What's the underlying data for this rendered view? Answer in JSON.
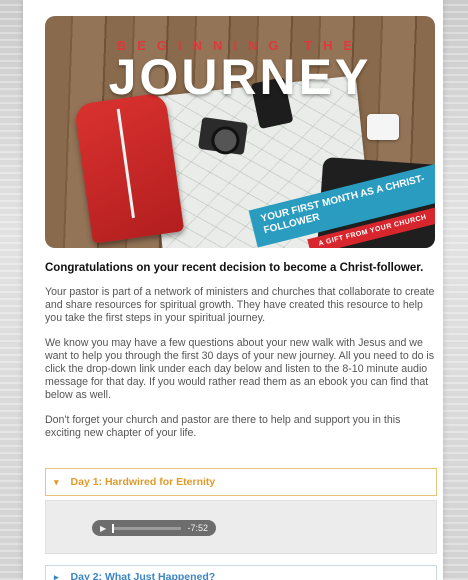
{
  "hero": {
    "title_top": "BEGINNING THE",
    "title_main": "JOURNEY",
    "banner": "YOUR FIRST MONTH AS A CHRIST-FOLLOWER",
    "gift": "A GIFT FROM YOUR CHURCH"
  },
  "content": {
    "headline": "Congratulations on your recent decision to become a Christ-follower.",
    "paragraphs": [
      "Your pastor is part of a network of ministers and churches that collaborate to create and share resources for spiritual growth. They have created this resource to help you take the first steps in your spiritual journey.",
      "We know you may have a few questions about your new walk with Jesus and we want to help you through the first 30 days of your new journey. All you need to do is click the drop-down link under each day below and listen to the 8-10 minute audio message for that day. If you would rather read them as an ebook you can find that below as well.",
      "Don't forget your church and pastor are there to help and support you in this exciting new chapter of your life."
    ]
  },
  "days": [
    {
      "label": "Day 1: Hardwired for Eternity",
      "expanded": true
    },
    {
      "label": "Day 2: What Just Happened?",
      "expanded": false
    }
  ],
  "player": {
    "time": "-7:52",
    "play_icon": "play-icon"
  },
  "colors": {
    "accent_orange": "#e19a2a",
    "accent_blue": "#3d86c6",
    "banner_blue": "#2a9cc0",
    "brand_red": "#e0383b"
  }
}
